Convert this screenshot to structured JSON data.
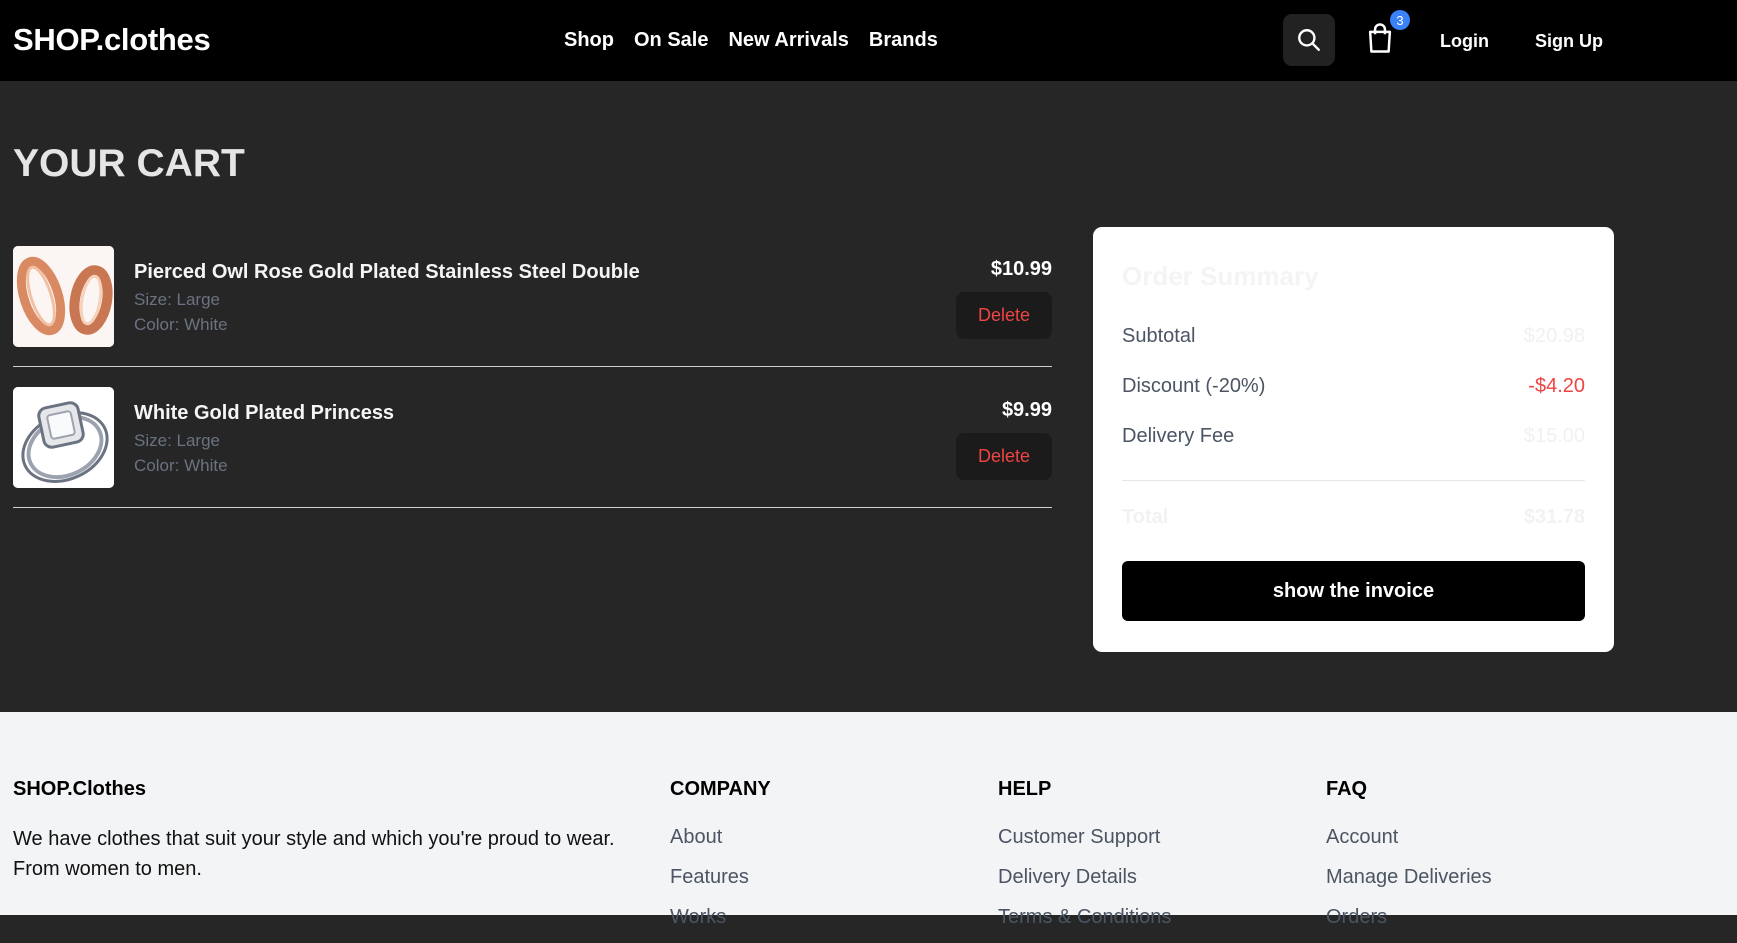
{
  "nav": {
    "logo": "SHOP.clothes",
    "links": [
      "Shop",
      "On Sale",
      "New Arrivals",
      "Brands"
    ],
    "cart_count": "3",
    "login": "Login",
    "signup": "Sign Up"
  },
  "cart": {
    "title": "YOUR CART",
    "items": [
      {
        "name": "Pierced Owl Rose Gold Plated Stainless Steel Double",
        "size": "Size: Large",
        "color": "Color: White",
        "price": "$10.99",
        "delete_label": "Delete"
      },
      {
        "name": "White Gold Plated Princess",
        "size": "Size: Large",
        "color": "Color: White",
        "price": "$9.99",
        "delete_label": "Delete"
      }
    ]
  },
  "summary": {
    "title": "Order Summary",
    "subtotal_label": "Subtotal",
    "subtotal_value": "$20.98",
    "discount_label": "Discount (-20%)",
    "discount_value": "-$4.20",
    "delivery_label": "Delivery Fee",
    "delivery_value": "$15.00",
    "total_label": "Total",
    "total_value": "$31.78",
    "invoice_button": "show the invoice"
  },
  "footer": {
    "brand": "SHOP.Clothes",
    "description": "We have clothes that suit your style and which you're proud to wear. From women to men.",
    "columns": [
      {
        "title": "COMPANY",
        "links": [
          "About",
          "Features",
          "Works"
        ]
      },
      {
        "title": "HELP",
        "links": [
          "Customer Support",
          "Delivery Details",
          "Terms & Conditions"
        ]
      },
      {
        "title": "FAQ",
        "links": [
          "Account",
          "Manage Deliveries",
          "Orders"
        ]
      }
    ]
  },
  "colors": {
    "accent_blue": "#3b82f6",
    "danger_red": "#ef4444",
    "page_bg": "#262626"
  }
}
